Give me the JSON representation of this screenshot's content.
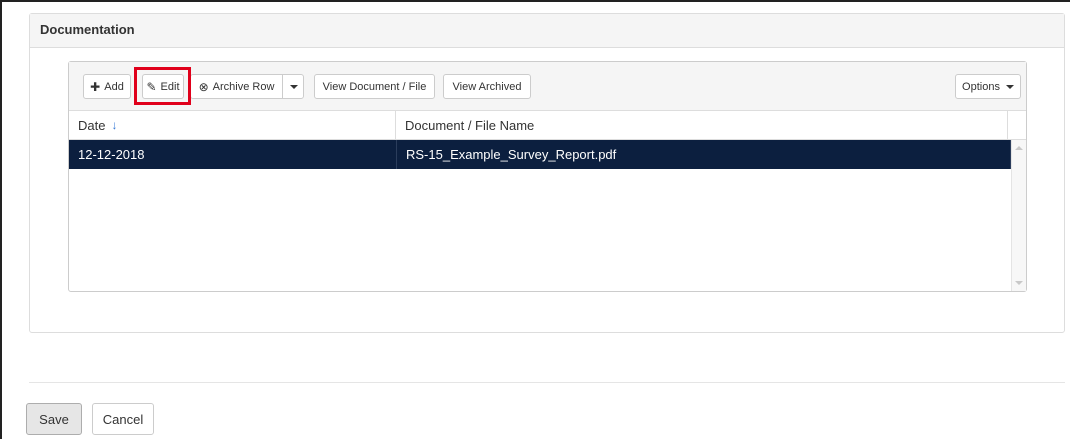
{
  "panel": {
    "title": "Documentation"
  },
  "toolbar": {
    "add_label": "Add",
    "edit_label": "Edit",
    "archive_row_label": "Archive Row",
    "view_document_label": "View Document / File",
    "view_archived_label": "View Archived",
    "options_label": "Options"
  },
  "table": {
    "columns": [
      "Date",
      "Document / File Name"
    ],
    "sort_column": "Date",
    "sort_direction": "descending",
    "rows": [
      {
        "date": "12-12-2018",
        "file_name": "RS-15_Example_Survey_Report.pdf",
        "selected": true
      }
    ]
  },
  "footer": {
    "save_label": "Save",
    "cancel_label": "Cancel"
  },
  "colors": {
    "selected_row_bg": "#0c1f3f",
    "highlight_border": "#e0001b",
    "sort_arrow": "#3a7bd5"
  },
  "icons": {
    "add": "plus-icon",
    "edit": "pencil-icon",
    "archive": "circle-x-icon",
    "sort": "arrow-down-icon",
    "dropdown": "caret-down-icon"
  }
}
